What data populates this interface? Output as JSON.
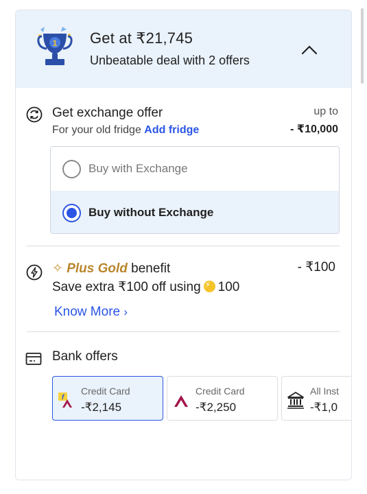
{
  "header": {
    "title": "Get at ₹21,745",
    "subtitle": "Unbeatable deal with 2 offers"
  },
  "exchange": {
    "title": "Get exchange offer",
    "subtitle_prefix": "For your old fridge",
    "add_link": "Add fridge",
    "upto_label": "up to",
    "upto_amount": "- ₹10,000",
    "options": [
      {
        "label": "Buy with Exchange",
        "selected": false
      },
      {
        "label": "Buy without Exchange",
        "selected": true
      }
    ]
  },
  "plus_gold": {
    "brand": "Plus Gold",
    "title_suffix": "benefit",
    "amount": "- ₹100",
    "subtitle_prefix": "Save extra ₹100 off using",
    "coin_value": "100",
    "know_more": "Know More"
  },
  "bank_offers": {
    "title": "Bank offers",
    "cards": [
      {
        "label": "Credit Card",
        "value": "-₹2,145",
        "selected": true,
        "logo": "flipkart-axis-icon"
      },
      {
        "label": "Credit Card",
        "value": "-₹2,250",
        "selected": false,
        "logo": "axis-bank-icon"
      },
      {
        "label": "All Inst",
        "value": "-₹1,0",
        "selected": false,
        "logo": "bank-building-icon"
      }
    ]
  },
  "colors": {
    "accent": "#2a55e5",
    "header_bg": "#eaf2fb",
    "gold": "#b8862b",
    "axis_maroon": "#a3154a"
  }
}
